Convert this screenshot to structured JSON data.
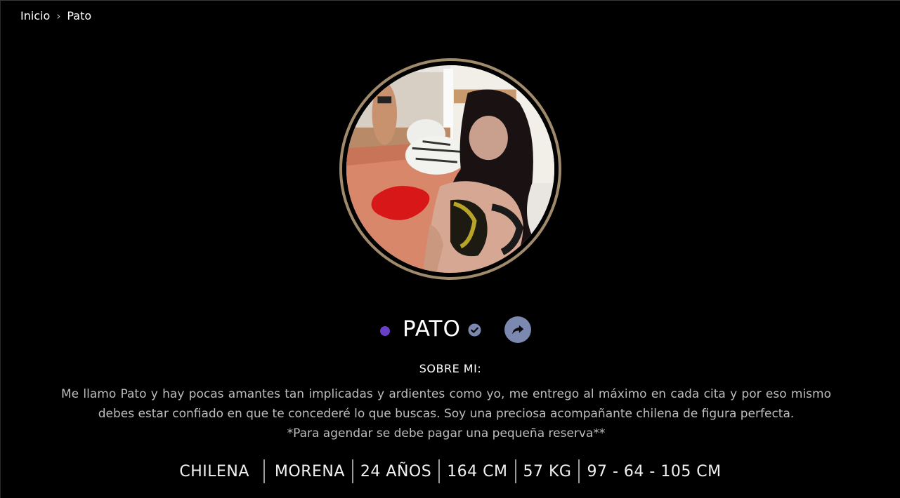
{
  "breadcrumb": {
    "home": "Inicio",
    "separator": "›",
    "current": "Pato"
  },
  "profile": {
    "name": "PATO",
    "online_color": "#6a3fc8",
    "verified_icon": "check-circle-icon",
    "share_icon": "share-arrow-icon",
    "photo_border_color": "#a08a6c"
  },
  "about": {
    "title": "SOBRE MI:",
    "paragraph": "Me llamo Pato y hay pocas amantes tan implicadas y ardientes como yo, me entrego al máximo en cada cita y por eso mismo debes estar confiado en que te concederé lo que buscas. Soy una preciosa acompañante chilena de figura perfecta.",
    "note": "*Para agendar se debe pagar una pequeña reserva**"
  },
  "attributes": [
    "CHILENA",
    "MORENA",
    "24 AÑOS",
    "164 CM",
    "57 KG",
    "97 - 64 - 105 CM"
  ]
}
